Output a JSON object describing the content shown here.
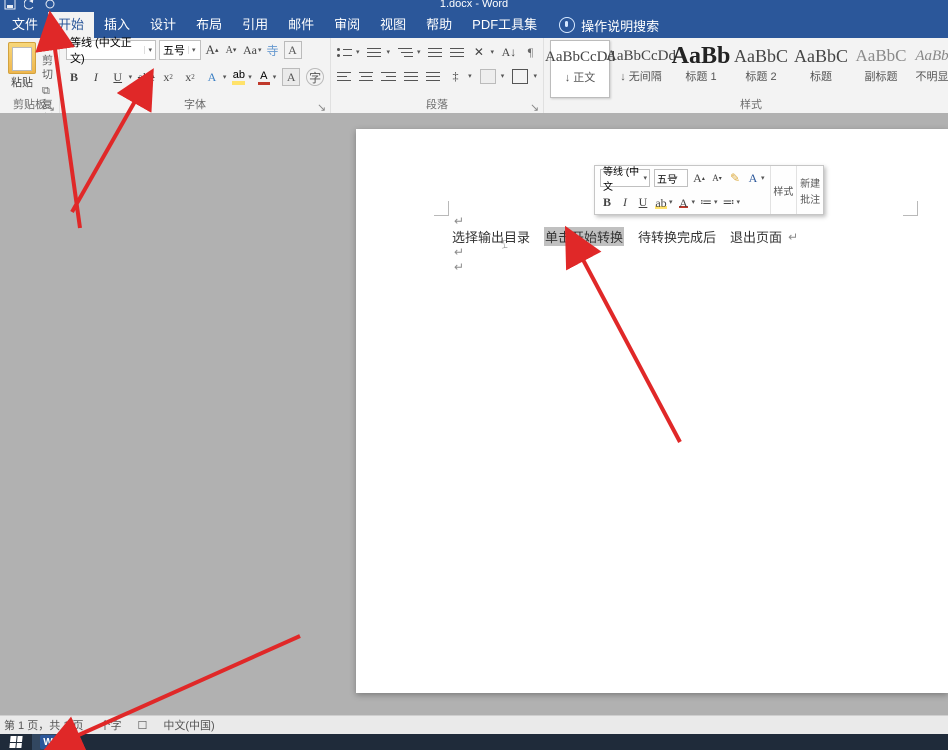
{
  "title": {
    "doc_name": "1.docx",
    "app_name": "Word"
  },
  "qat": {
    "save": "save-icon",
    "undo": "undo-icon",
    "redo": "redo-icon"
  },
  "tabs": {
    "file": "文件",
    "home": "开始",
    "insert": "插入",
    "design": "设计",
    "layout": "布局",
    "references": "引用",
    "mailings": "邮件",
    "review": "审阅",
    "view": "视图",
    "help": "帮助",
    "pdf_tools": "PDF工具集",
    "tell_me": "操作说明搜索"
  },
  "clipboard": {
    "paste": "粘贴",
    "cut": "剪切",
    "copy": "复制",
    "format_painter": "格式刷",
    "group_label": "剪贴板"
  },
  "font": {
    "font_name": "等线 (中文正文)",
    "font_size": "五号",
    "group_label": "字体"
  },
  "paragraph": {
    "group_label": "段落"
  },
  "styles": {
    "group_label": "样式",
    "items": [
      {
        "sample": "AaBbCcDd",
        "name": "↓ 正文"
      },
      {
        "sample": "AaBbCcDd",
        "name": "↓ 无间隔"
      },
      {
        "sample": "AaBb",
        "name": "标题 1"
      },
      {
        "sample": "AaBbC",
        "name": "标题 2"
      },
      {
        "sample": "AaBbC",
        "name": "标题"
      },
      {
        "sample": "AaBbC",
        "name": "副标题"
      },
      {
        "sample": "AaBb",
        "name": "不明显"
      }
    ]
  },
  "mini_toolbar": {
    "font_name": "等线 (中文",
    "font_size": "五号",
    "styles_label": "样式",
    "new_comment_l1": "新建",
    "new_comment_l2": "批注"
  },
  "document": {
    "text": [
      "选择输出目录",
      "单击开始转换",
      "待转换完成后",
      "退出页面"
    ],
    "return_char": "↵",
    "para_char": "↵"
  },
  "status_bar": {
    "page_info": "第 1 页，共 1 页",
    "word_count": "个字",
    "language": "中文(中国)"
  },
  "taskbar": {
    "start": "start",
    "word": "W"
  },
  "colors": {
    "accent": "#2b579a",
    "annotation": "#e02828"
  }
}
